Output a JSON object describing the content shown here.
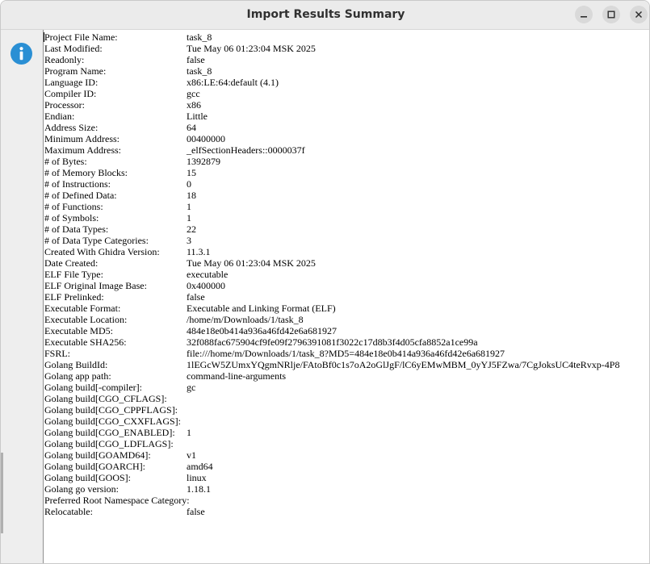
{
  "window": {
    "title": "Import Results Summary"
  },
  "icons": {
    "info": "info-icon",
    "minimize": "minimize-icon",
    "maximize": "maximize-icon",
    "close": "close-icon"
  },
  "colors": {
    "info_icon": "#2a8fd4",
    "titlebar": "#ebebeb",
    "panel": "#ffffff"
  },
  "summary": [
    {
      "key": "Project File Name:",
      "value": "task_8"
    },
    {
      "key": "Last Modified:",
      "value": "Tue May 06 01:23:04 MSK 2025"
    },
    {
      "key": "Readonly:",
      "value": "false"
    },
    {
      "key": "Program Name:",
      "value": "task_8"
    },
    {
      "key": "Language ID:",
      "value": "x86:LE:64:default (4.1)"
    },
    {
      "key": "Compiler ID:",
      "value": "gcc"
    },
    {
      "key": "Processor:",
      "value": "x86"
    },
    {
      "key": "Endian:",
      "value": "Little"
    },
    {
      "key": "Address Size:",
      "value": "64"
    },
    {
      "key": "Minimum Address:",
      "value": "00400000"
    },
    {
      "key": "Maximum Address:",
      "value": "_elfSectionHeaders::0000037f"
    },
    {
      "key": "# of Bytes:",
      "value": "1392879"
    },
    {
      "key": "# of Memory Blocks:",
      "value": "15"
    },
    {
      "key": "# of Instructions:",
      "value": "0"
    },
    {
      "key": "# of Defined Data:",
      "value": "18"
    },
    {
      "key": "# of Functions:",
      "value": "1"
    },
    {
      "key": "# of Symbols:",
      "value": "1"
    },
    {
      "key": "# of Data Types:",
      "value": "22"
    },
    {
      "key": "# of Data Type Categories:",
      "value": "3"
    },
    {
      "key": "Created With Ghidra Version:",
      "value": "11.3.1"
    },
    {
      "key": "Date Created:",
      "value": "Tue May 06 01:23:04 MSK 2025"
    },
    {
      "key": "ELF File Type:",
      "value": "executable"
    },
    {
      "key": "ELF Original Image Base:",
      "value": "0x400000"
    },
    {
      "key": "ELF Prelinked:",
      "value": "false"
    },
    {
      "key": "Executable Format:",
      "value": "Executable and Linking Format (ELF)"
    },
    {
      "key": "Executable Location:",
      "value": "/home/m/Downloads/1/task_8"
    },
    {
      "key": "Executable MD5:",
      "value": "484e18e0b414a936a46fd42e6a681927"
    },
    {
      "key": "Executable SHA256:",
      "value": "32f088fac675904cf9fe09f2796391081f3022c17d8b3f4d05cfa8852a1ce99a"
    },
    {
      "key": "FSRL:",
      "value": "file:///home/m/Downloads/1/task_8?MD5=484e18e0b414a936a46fd42e6a681927"
    },
    {
      "key": "Golang BuildId:",
      "value": "1lEGcW5ZUmxYQgmNRlje/FAtoBf0c1s7oA2oGlJgF/lC6yEMwMBM_0yYJ5FZwa/7CgJoksUC4teRvxp-4P8"
    },
    {
      "key": "Golang app path:",
      "value": "command-line-arguments"
    },
    {
      "key": "Golang build[-compiler]:",
      "value": "gc"
    },
    {
      "key": "Golang build[CGO_CFLAGS]:",
      "value": ""
    },
    {
      "key": "Golang build[CGO_CPPFLAGS]:",
      "value": ""
    },
    {
      "key": "Golang build[CGO_CXXFLAGS]:",
      "value": ""
    },
    {
      "key": "Golang build[CGO_ENABLED]:",
      "value": "1"
    },
    {
      "key": "Golang build[CGO_LDFLAGS]:",
      "value": ""
    },
    {
      "key": "Golang build[GOAMD64]:",
      "value": "v1"
    },
    {
      "key": "Golang build[GOARCH]:",
      "value": "amd64"
    },
    {
      "key": "Golang build[GOOS]:",
      "value": "linux"
    },
    {
      "key": "Golang go version:",
      "value": "1.18.1"
    },
    {
      "key": "Preferred Root Namespace Category:",
      "value": ""
    },
    {
      "key": "Relocatable:",
      "value": "false"
    }
  ]
}
